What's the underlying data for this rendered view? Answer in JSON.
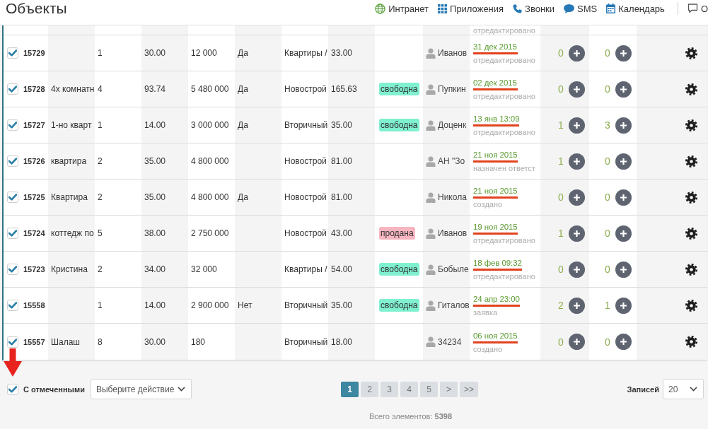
{
  "page": {
    "title": "Объекты"
  },
  "nav": [
    {
      "label": "Интранет"
    },
    {
      "label": "Приложения"
    },
    {
      "label": "Звонки"
    },
    {
      "label": "SMS"
    },
    {
      "label": "Календарь"
    }
  ],
  "nav_right": {
    "label": "О"
  },
  "table": {
    "partial_row": {
      "note": "отредактировано"
    },
    "rows": [
      {
        "checked": true,
        "column_2": "15729",
        "column_4": "1",
        "column_5": "30.00",
        "column_6": "12 000",
        "column_7": "Да",
        "column_8": "Квартиры /",
        "column_9": "33.00",
        "person": "Иванов",
        "date": "31 дек 2015",
        "note": "отредактировано",
        "count_1": "0",
        "count_2": "0"
      },
      {
        "checked": true,
        "column_2": "15728",
        "column_3": "4х комнатн",
        "column_4": "4",
        "column_5": "93.74",
        "column_6": "5 480 000",
        "column_7": "Да",
        "column_8": "Новострой",
        "column_9": "165.63",
        "tag": {
          "text": "свободна",
          "color": "#7ff0d0"
        },
        "person": "Пупкин",
        "date": "02 дек 2015",
        "note": "отредактировано",
        "count_1": "0",
        "count_2": "0"
      },
      {
        "checked": true,
        "column_2": "15727",
        "column_3": "1-но кварт",
        "column_4": "1",
        "column_5": "14.00",
        "column_6": "3 000 000",
        "column_7": "Да",
        "column_8": "Вторичный",
        "column_9": "35.00",
        "tag": {
          "text": "свободна",
          "color": "#7ff0d0"
        },
        "person": "Доценк",
        "date": "13 янв 13:09",
        "note": "отредактировано",
        "count_1": "1",
        "count_2": "3"
      },
      {
        "checked": true,
        "column_2": "15726",
        "column_3": "квартира",
        "column_4": "2",
        "column_5": "35.00",
        "column_6": "4 800 000",
        "column_8": "Новострой",
        "column_9": "81.00",
        "person": "АН \"Зо",
        "date": "21 ноя 2015",
        "note": "назначен ответст",
        "count_1": "1",
        "count_2": "0"
      },
      {
        "checked": true,
        "column_2": "15725",
        "column_3": "Квартира",
        "column_4": "2",
        "column_5": "35.00",
        "column_6": "4 800 000",
        "column_7": "Да",
        "column_8": "Новострой",
        "column_9": "81.00",
        "person": "Никола",
        "date": "21 ноя 2015",
        "note": "создано",
        "count_1": "0",
        "count_2": "0"
      },
      {
        "checked": true,
        "column_2": "15724",
        "column_3": "коттедж по",
        "column_4": "5",
        "column_5": "38.00",
        "column_6": "2 750 000",
        "column_8": "Новострой",
        "column_9": "43.00",
        "tag": {
          "text": "продана",
          "color": "#f8b5c0"
        },
        "person": "Иванов",
        "date": "19 ноя 2015",
        "note": "отредактировано",
        "count_1": "1",
        "count_2": "0"
      },
      {
        "checked": true,
        "column_2": "15723",
        "column_3": "Кристина",
        "column_4": "2",
        "column_5": "34.00",
        "column_6": "32 000",
        "column_8": "Квартиры /",
        "column_9": "54.00",
        "tag": {
          "text": "свободна",
          "color": "#7ff0d0"
        },
        "person": "Бобыле",
        "date": "18 фев 09:32",
        "note": "отредактировано",
        "count_1": "0",
        "count_2": "0"
      },
      {
        "checked": true,
        "column_2": "15558",
        "column_4": "1",
        "column_5": "14.00",
        "column_6": "2 900 000",
        "column_7": "Нет",
        "column_8": "Вторичный",
        "column_9": "35.00",
        "tag": {
          "text": "свободна",
          "color": "#7ff0d0"
        },
        "person": "Гиталов",
        "date": "24 апр 23:00",
        "note": "заявка",
        "count_1": "2",
        "count_2": "1"
      },
      {
        "checked": true,
        "column_2": "15557",
        "column_3": "Шалаш",
        "column_4": "8",
        "column_5": "30.00",
        "column_6": "180",
        "column_8": "Вторичный",
        "column_9": "18.00",
        "person": "34234",
        "date": "06 ноя 2015",
        "note": "создано",
        "count_1": "0",
        "count_2": "0"
      }
    ]
  },
  "footer": {
    "bulk": {
      "checked": true,
      "label": "С отмеченными"
    },
    "action_select": {
      "value": "Выберите действие"
    },
    "pages": [
      {
        "label": "1",
        "selected": true
      },
      {
        "label": "2",
        "selected": false
      },
      {
        "label": "3",
        "selected": false
      },
      {
        "label": "4",
        "selected": false
      },
      {
        "label": "5",
        "selected": false
      },
      {
        "label": ">",
        "selected": false
      },
      {
        "label": ">>",
        "selected": false
      }
    ],
    "per_page": {
      "label": "Записей",
      "value": "20"
    },
    "total": "Всего элементов: **5398**"
  }
}
